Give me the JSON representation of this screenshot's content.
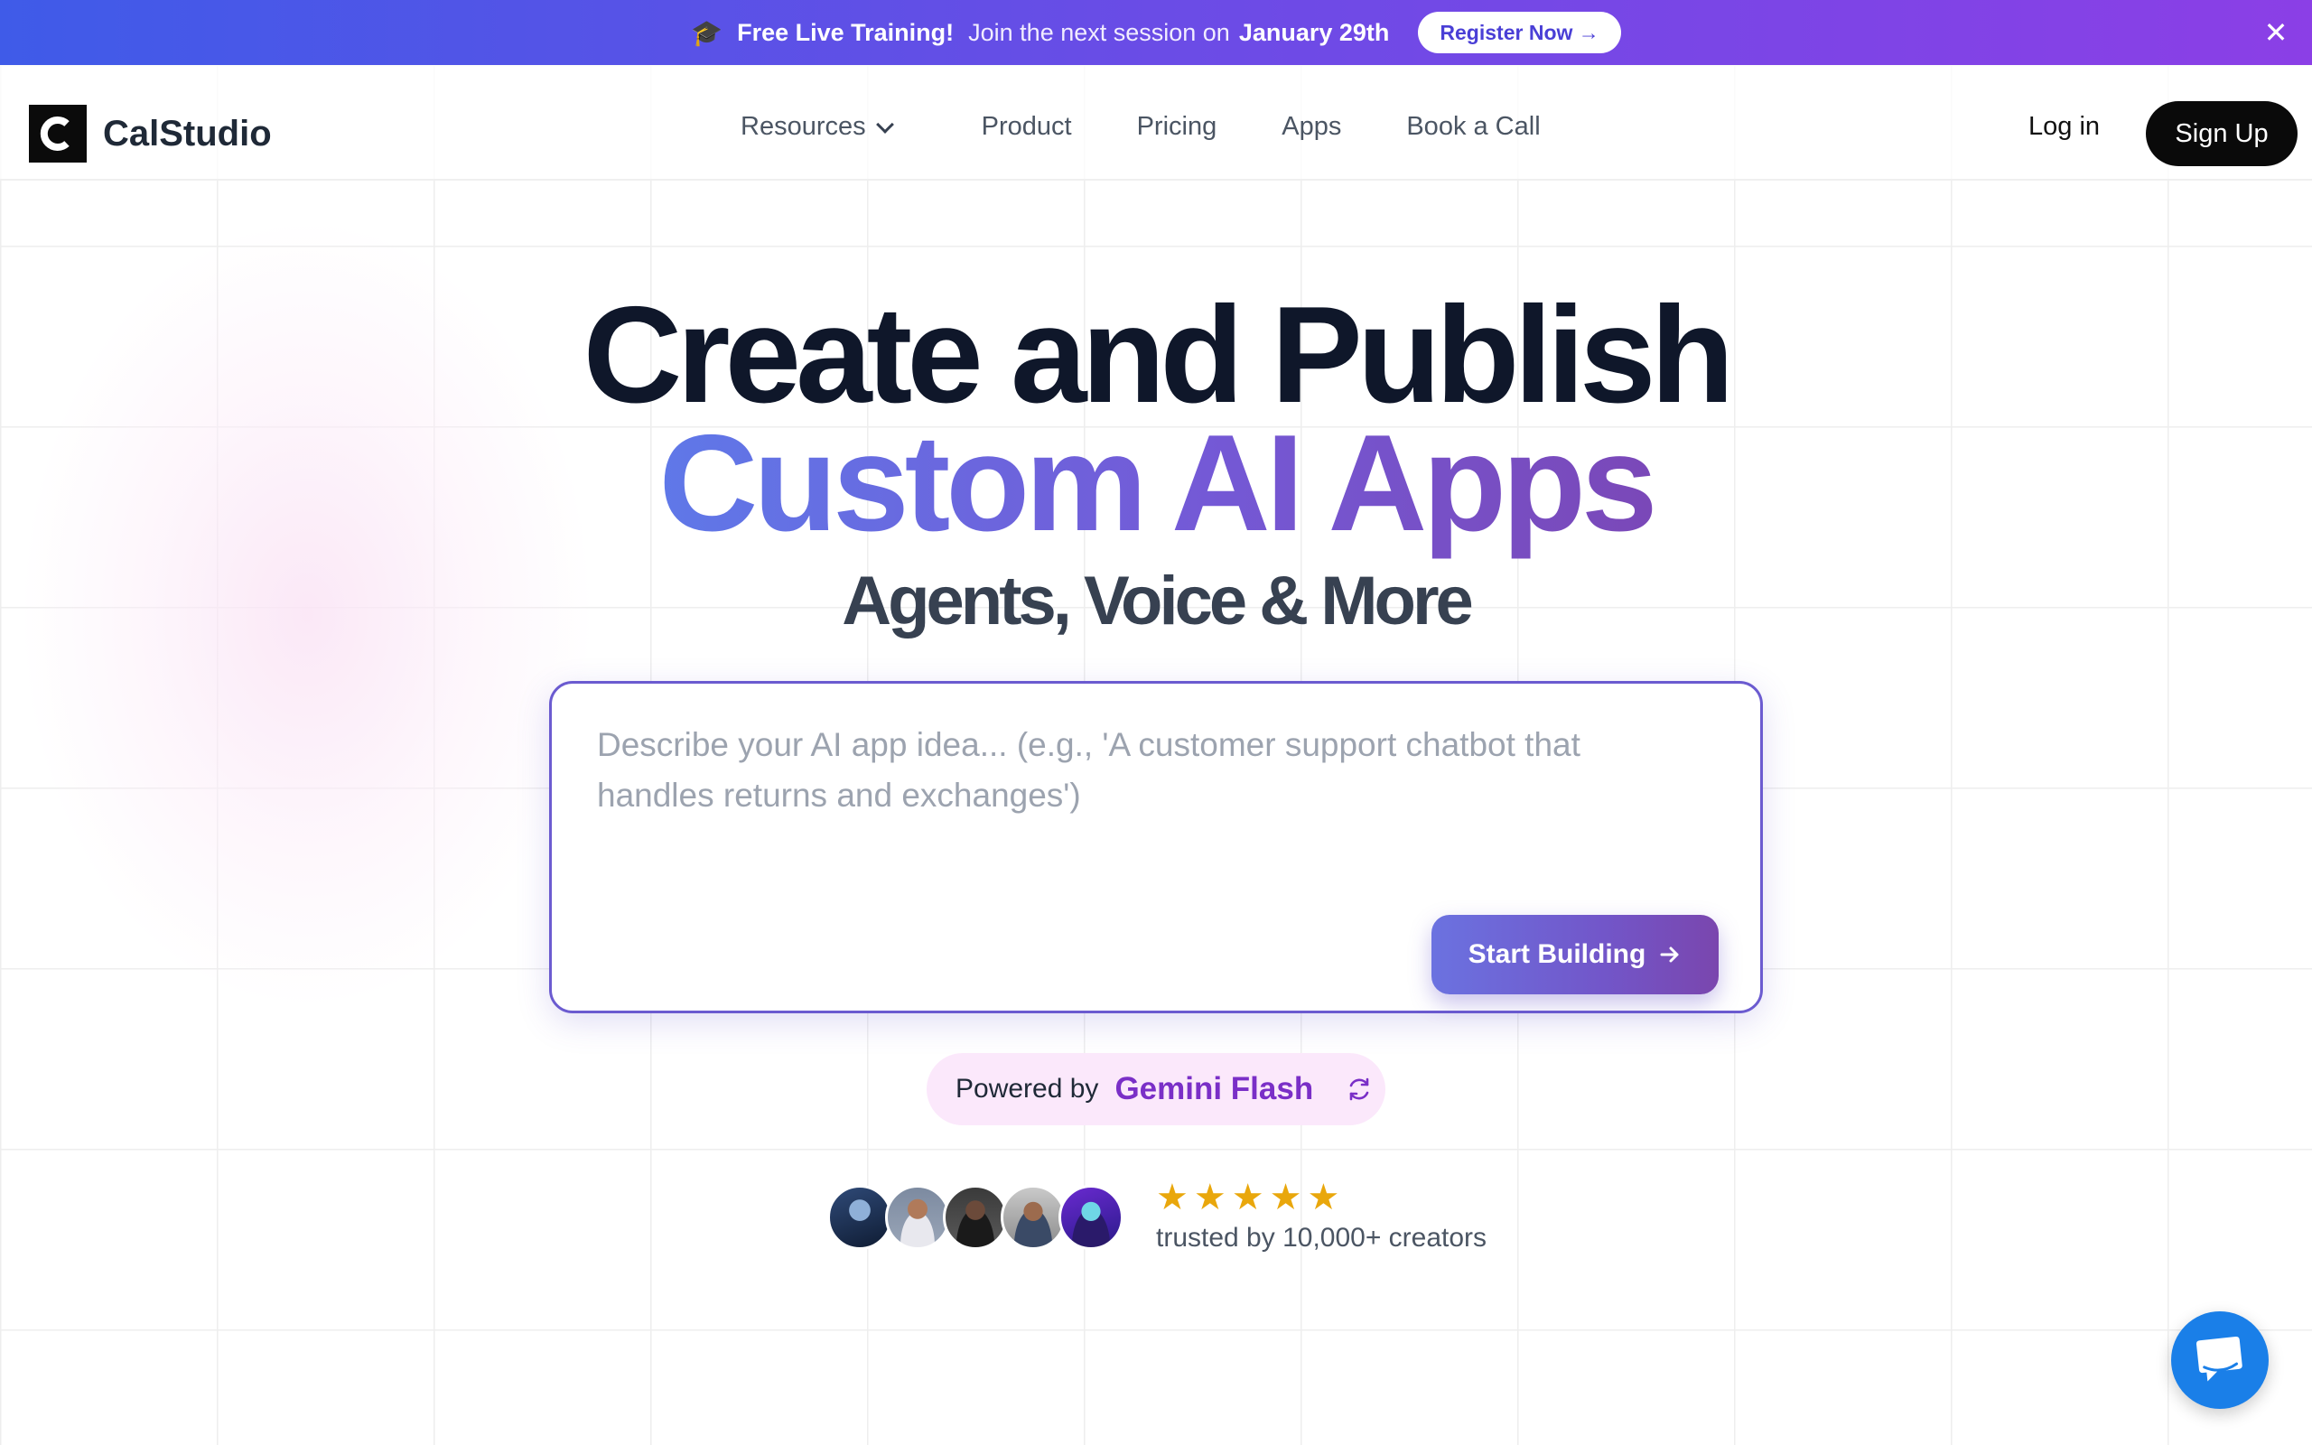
{
  "banner": {
    "icon": "graduation-cap-icon",
    "strong": "Free Live Training!",
    "text": "Join the next session on",
    "date": "January 29th",
    "button_label": "Register Now →",
    "close_icon": "close-icon"
  },
  "header": {
    "brand": "CalStudio",
    "logo_letter": "C",
    "nav": [
      "Resources",
      "Product",
      "Pricing",
      "Apps",
      "Book a Call"
    ],
    "login": "Log in",
    "signup": "Sign Up"
  },
  "hero": {
    "title": "Create and Publish",
    "subtitle": "Custom AI Apps",
    "tagline": "Agents, Voice & More"
  },
  "prompt": {
    "placeholder": "Describe your AI app idea... (e.g., 'A customer support chatbot that handles returns and exchanges')",
    "value": "",
    "button_label": "Start Building"
  },
  "powered": {
    "label": "Powered by",
    "model": "Gemini Flash"
  },
  "social": {
    "stars": 5,
    "trusted": "trusted by 10,000+ creators"
  },
  "colors": {
    "banner_start": "#3f5be8",
    "banner_end": "#8b3fe6",
    "accent": "#6b5bd0",
    "star": "#e9a70c",
    "chat": "#1a7fe8"
  }
}
